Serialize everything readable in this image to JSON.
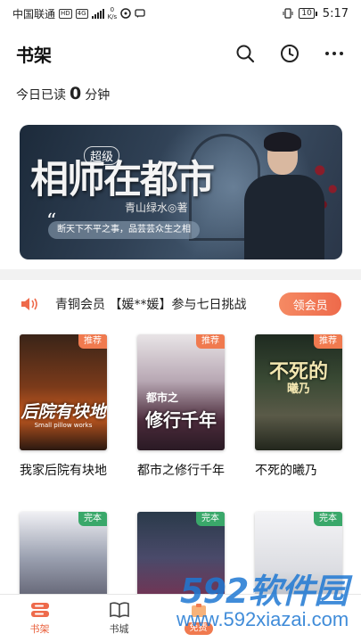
{
  "status_bar": {
    "carrier": "中国联通",
    "hd": "HD",
    "network": "4G",
    "speed_value": "0",
    "speed_unit": "K/s",
    "battery": "10",
    "time": "5:17"
  },
  "header": {
    "title": "书架",
    "icons": [
      "search-icon",
      "history-clock-icon",
      "more-icon"
    ]
  },
  "reading": {
    "prefix": "今日已读",
    "minutes": "0",
    "unit": "分钟"
  },
  "banner": {
    "tag": "超级",
    "title": "相师在都市",
    "author": "青山绿水◎著",
    "quote": "断天下不平之事，品芸芸众生之相"
  },
  "notice": {
    "text": "青铜会员 【媛**媛】参与七日挑战",
    "button": "领会员"
  },
  "books": [
    {
      "title": "我家后院有块地",
      "badge": "推荐",
      "cover_text": "后院有块地",
      "cover_sub": "Small pillow works"
    },
    {
      "title": "都市之修行千年",
      "badge": "推荐",
      "cover_text": "修行千年",
      "cover_sub": "都市之"
    },
    {
      "title": "不死的曦乃",
      "badge": "推荐",
      "cover_text": "不死的",
      "cover_sub": "曦乃"
    },
    {
      "title": "",
      "badge": "完本",
      "cover_text": "",
      "cover_sub": ""
    },
    {
      "title": "",
      "badge": "完本",
      "cover_text": "",
      "cover_sub": ""
    },
    {
      "title": "",
      "badge": "完本",
      "cover_text": "",
      "cover_sub": ""
    }
  ],
  "bottom_nav": [
    {
      "label": "书架",
      "icon": "bookshelf-icon",
      "active": true
    },
    {
      "label": "书城",
      "icon": "open-book-icon",
      "active": false
    },
    {
      "label": "免费",
      "icon": "free-icon",
      "active": false
    }
  ],
  "watermark": {
    "big": "592软件园",
    "small": "www.592xiazai.com"
  },
  "colors": {
    "accent": "#ee6a4b",
    "badge_recommend": "#f07a4f",
    "badge_finished": "#3aa86a"
  }
}
